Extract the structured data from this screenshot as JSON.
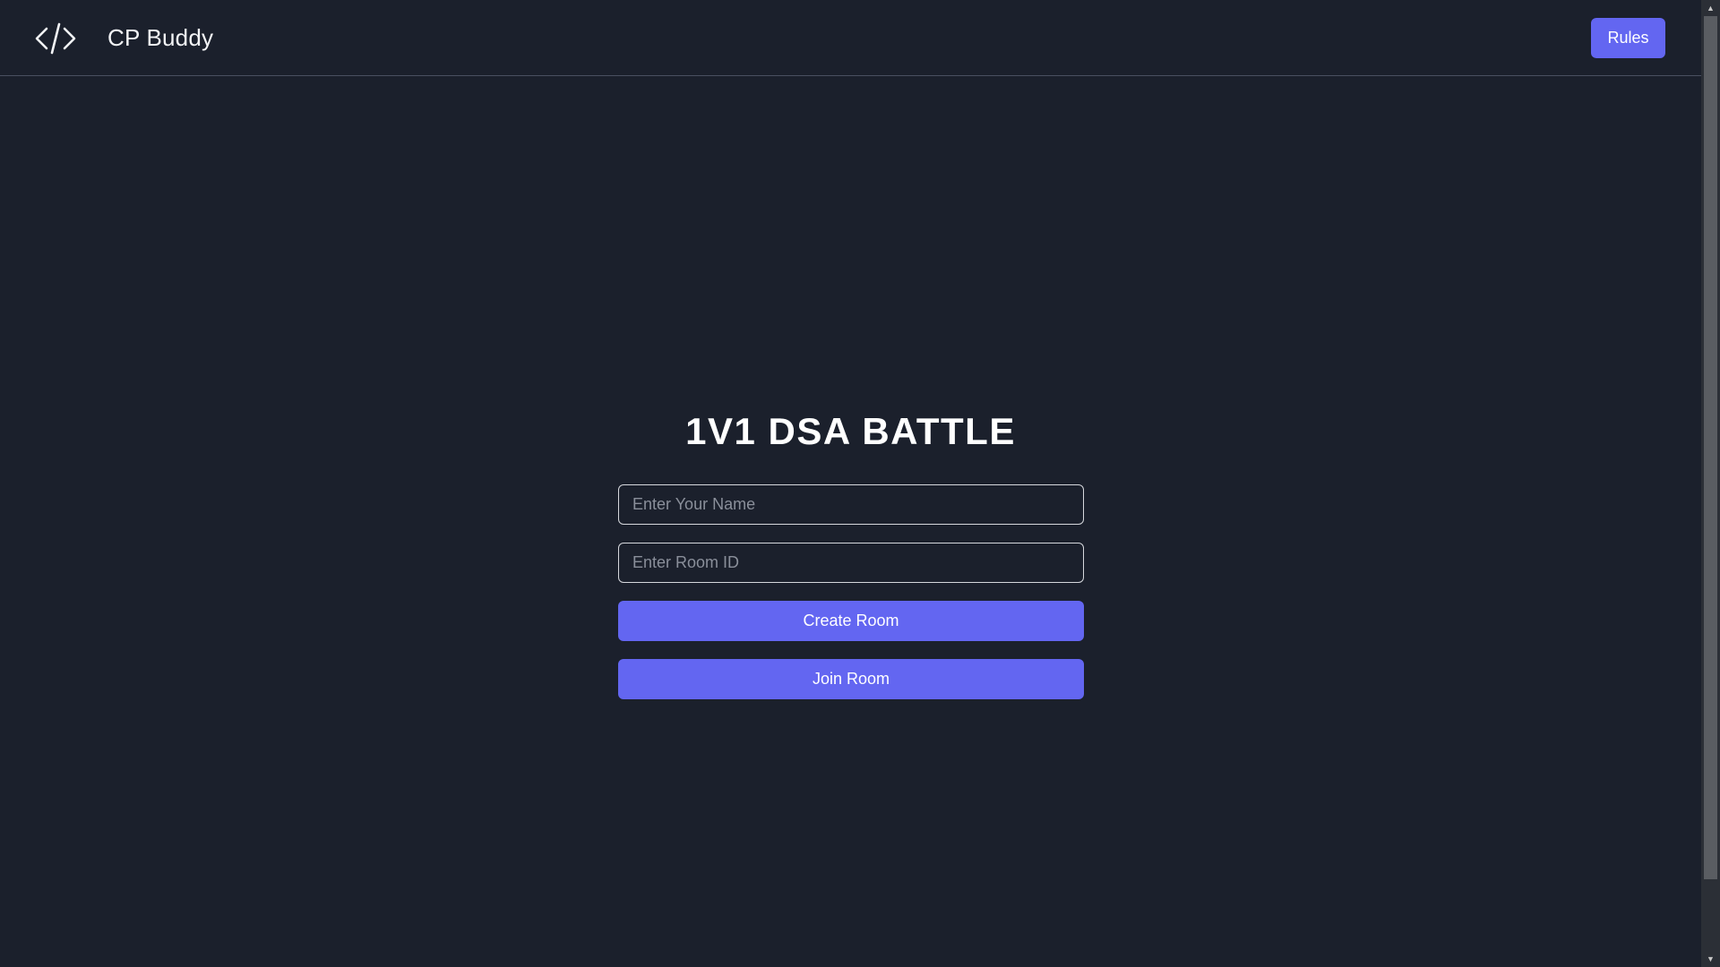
{
  "navbar": {
    "logo_icon": "code-brackets-icon",
    "brand": "CP Buddy",
    "rules_label": "Rules"
  },
  "main": {
    "title": "1V1 DSA BATTLE",
    "name_placeholder": "Enter Your Name",
    "name_value": "",
    "room_placeholder": "Enter Room ID",
    "room_value": "",
    "create_label": "Create Room",
    "join_label": "Join Room"
  },
  "scrollbar": {
    "up_icon": "scroll-up-arrow-icon",
    "down_icon": "scroll-down-arrow-icon"
  },
  "colors": {
    "background": "#1b202c",
    "accent": "#6366f1",
    "text": "#ffffff",
    "input_border": "#d6d8dd",
    "divider": "#4a5060"
  }
}
